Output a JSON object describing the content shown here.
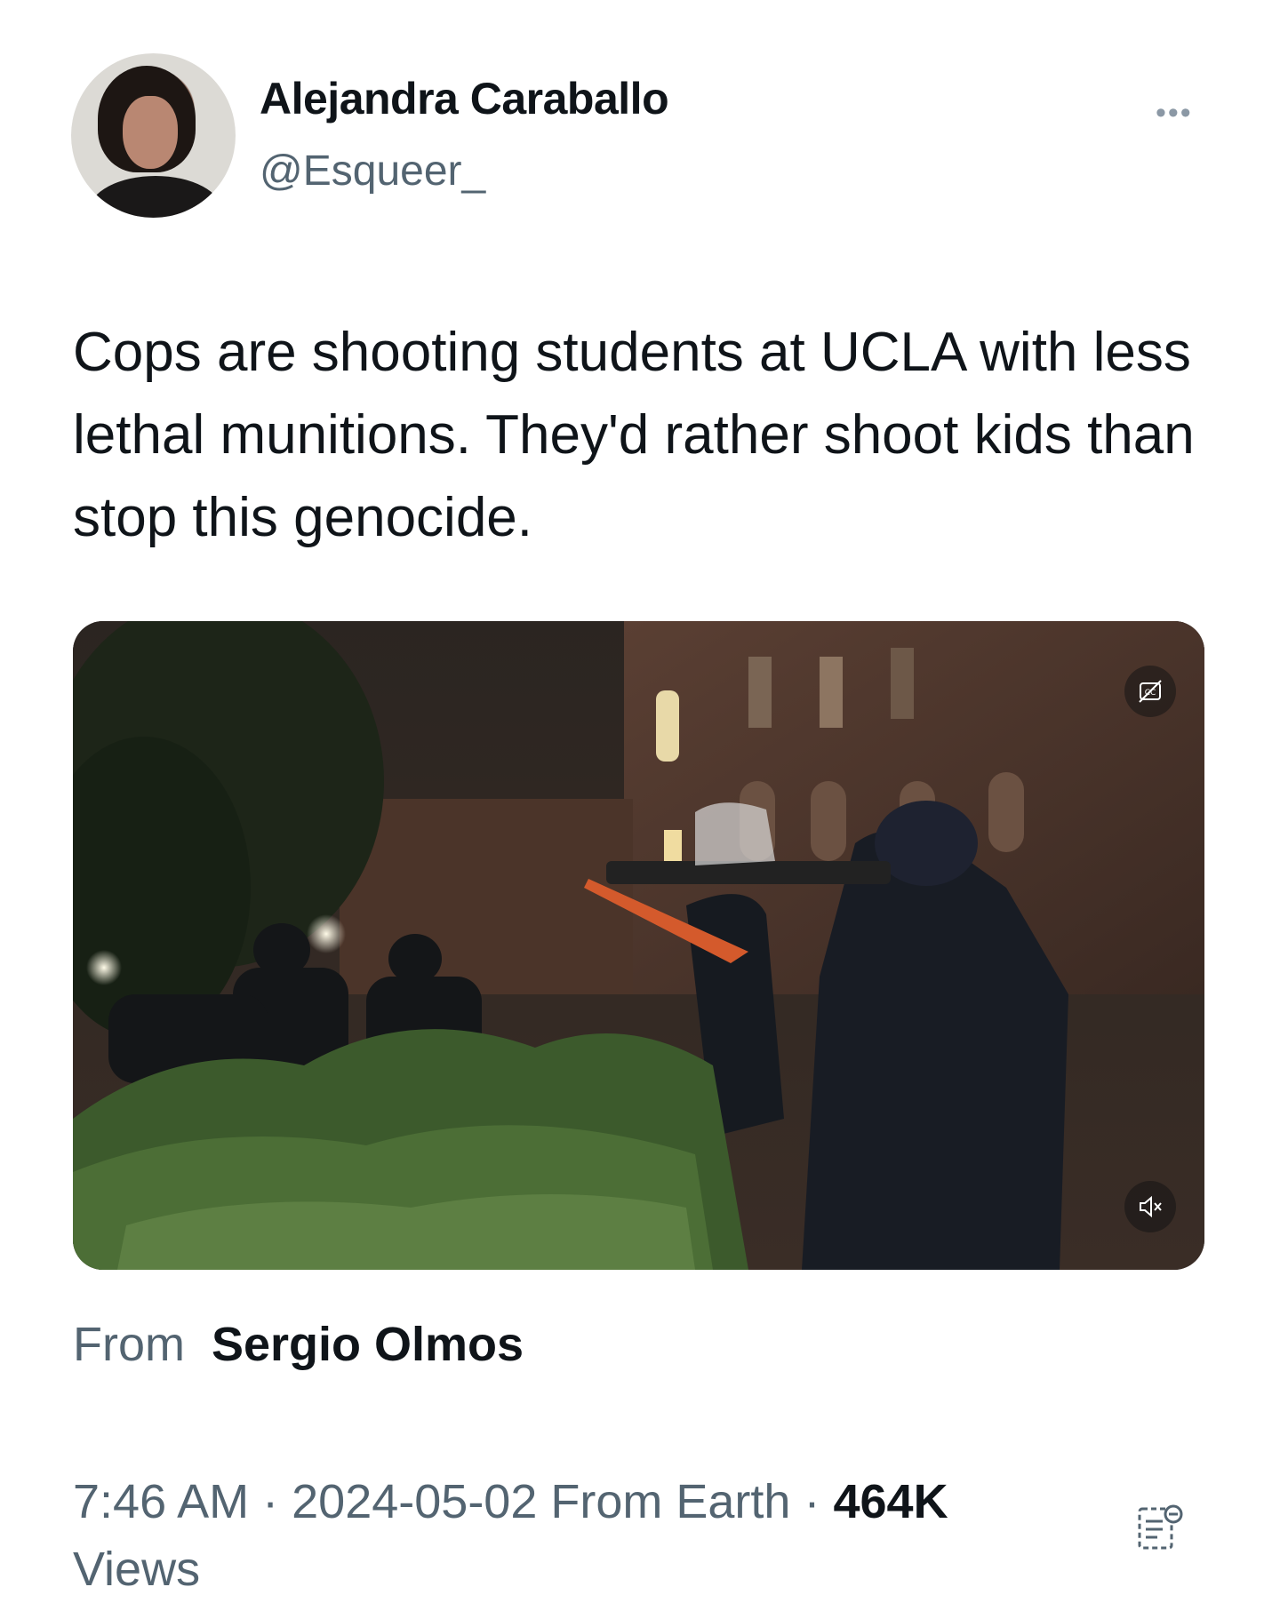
{
  "author": {
    "name": "Alejandra Caraballo",
    "handle": "@Esqueer_"
  },
  "icons": {
    "more": "more-options-icon",
    "captions": "captions-off-icon",
    "mute": "muted-speaker-icon",
    "notes": "community-notes-icon"
  },
  "tweet": {
    "text": "Cops are shooting students at UCLA with less lethal munitions. They'd rather shoot kids than stop this genocide."
  },
  "attribution": {
    "label": "From",
    "source_name": "Sergio Olmos"
  },
  "meta": {
    "time": "7:46 AM",
    "date": "2024-05-02",
    "location": "From Earth",
    "views_count": "464K",
    "views_label": "Views"
  },
  "colors": {
    "text_primary": "#0f1419",
    "text_secondary": "#536471"
  }
}
